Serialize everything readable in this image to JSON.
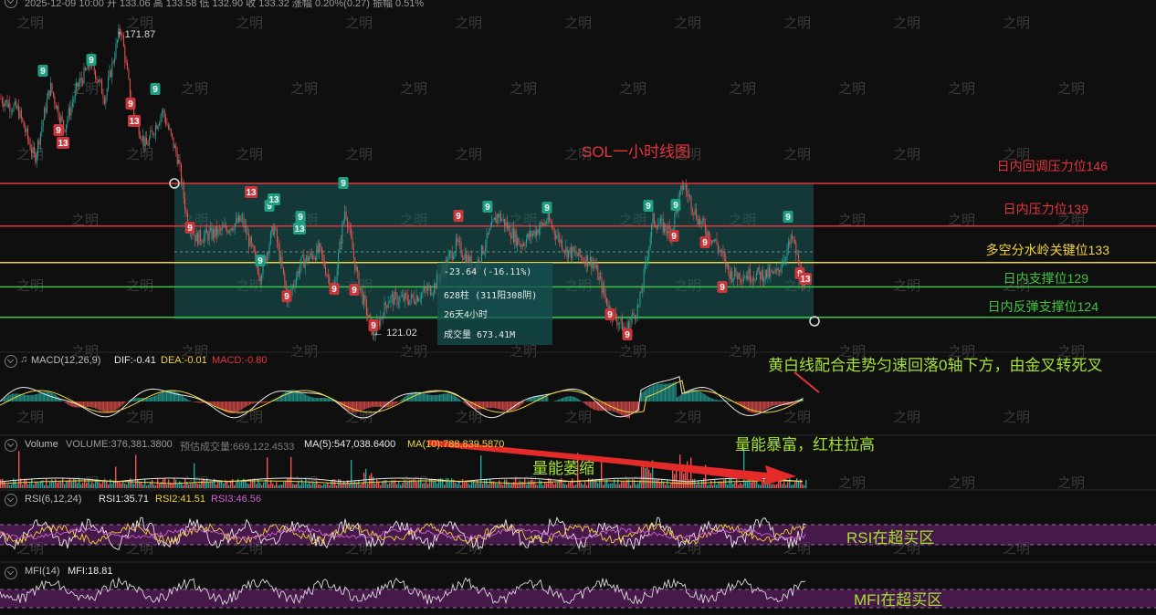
{
  "header": {
    "top_info": "2025-12-09 10:00  开 133.06  高 133.58  低 132.90  收 133.32  涨幅 0.20%(0.27)  振幅 0.51%"
  },
  "watermark": "之明",
  "chart_title": "SOL一小时线图",
  "price_marks": {
    "high": "171.87",
    "low": "121.02"
  },
  "levels": [
    {
      "label": "日内回调压力位146",
      "value": 146,
      "color": "#e5333c"
    },
    {
      "label": "日内压力位139",
      "value": 139,
      "color": "#e5333c"
    },
    {
      "label": "多空分水岭关键位133",
      "value": 133,
      "color": "#f0d43a"
    },
    {
      "label": "日内支撑位129",
      "value": 129,
      "color": "#3fc63f"
    },
    {
      "label": "日内反弹支撑位124",
      "value": 124,
      "color": "#3fc63f"
    }
  ],
  "tooltip": {
    "change": "-23.64 (-16.11%)",
    "bars": "628柱 (311阳308阴)",
    "duration": "26天4小时",
    "volume": "成交量 673.41M"
  },
  "macd": {
    "name": "MACD(12,26,9)",
    "dif": "DIF:-0.41",
    "dea": "DEA:-0.01",
    "macd": "MACD:-0.80",
    "note": "黄白线配合走势匀速回落0轴下方，由金叉转死叉"
  },
  "volume": {
    "name": "Volume",
    "vol": "VOLUME:376,381.3800",
    "est": "预估成交量:669,122.4533",
    "ma5": "MA(5):547,038.6400",
    "ma10": "MA(10):788,839.5870",
    "note1": "量能萎缩",
    "note2": "量能暴富，红柱拉高"
  },
  "rsi": {
    "name": "RSI(6,12,24)",
    "rsi1": "RSI1:35.71",
    "rsi2": "RSI2:41.51",
    "rsi3": "RSI3:46.56",
    "note": "RSI在超买区"
  },
  "mfi": {
    "name": "MFI(14)",
    "mfi": "MFI:18.81",
    "note": "MFI在超买区"
  },
  "td_markers": [
    {
      "t": "9",
      "k": "g"
    },
    {
      "t": "9",
      "k": "g"
    },
    {
      "t": "9",
      "k": "r"
    },
    {
      "t": "13",
      "k": "r"
    },
    {
      "t": "9",
      "k": "r"
    },
    {
      "t": "13",
      "k": "r"
    },
    {
      "t": "9",
      "k": "g"
    },
    {
      "t": "9",
      "k": "r"
    },
    {
      "t": "13",
      "k": "r"
    },
    {
      "t": "9",
      "k": "g"
    },
    {
      "t": "9",
      "k": "g"
    },
    {
      "t": "13",
      "k": "g"
    },
    {
      "t": "9",
      "k": "g"
    },
    {
      "t": "9",
      "k": "r"
    },
    {
      "t": "9",
      "k": "r"
    },
    {
      "t": "9",
      "k": "r"
    },
    {
      "t": "13",
      "k": "g"
    },
    {
      "t": "9",
      "k": "g"
    },
    {
      "t": "9",
      "k": "r"
    },
    {
      "t": "9",
      "k": "r"
    },
    {
      "t": "9",
      "k": "g"
    },
    {
      "t": "9",
      "k": "g"
    },
    {
      "t": "9",
      "k": "g"
    },
    {
      "t": "9",
      "k": "r"
    },
    {
      "t": "9",
      "k": "r"
    },
    {
      "t": "9",
      "k": "g"
    },
    {
      "t": "9",
      "k": "r"
    },
    {
      "t": "9",
      "k": "r"
    },
    {
      "t": "9",
      "k": "r"
    },
    {
      "t": "9",
      "k": "g"
    },
    {
      "t": "9",
      "k": "r"
    },
    {
      "t": "13",
      "k": "r"
    }
  ],
  "chart_data": {
    "type": "line",
    "title": "SOL一小时线图",
    "high_price": 171.87,
    "low_price": 121.02,
    "key_levels": [
      146,
      139,
      133,
      129,
      124
    ],
    "indicators": [
      "MACD(12,26,9)",
      "Volume",
      "RSI(6,12,24)",
      "MFI(14)"
    ]
  }
}
